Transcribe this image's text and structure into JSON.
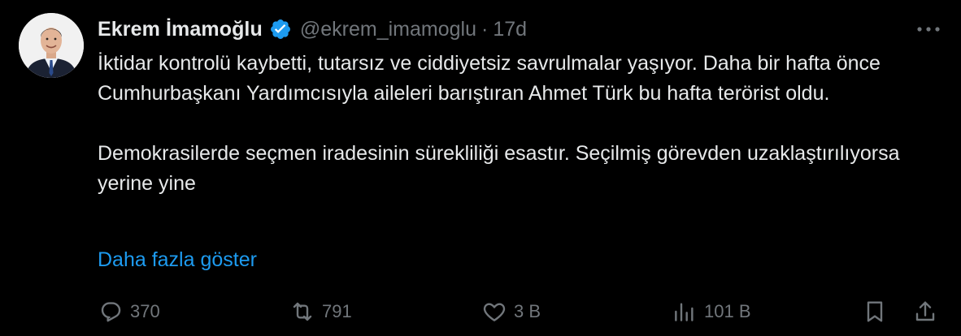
{
  "author": {
    "display_name": "Ekrem İmamoğlu",
    "handle": "@ekrem_imamoglu",
    "separator": "·",
    "time": "17d",
    "verified_icon": "verified-badge-icon"
  },
  "tweet": {
    "paragraphs": [
      "İktidar kontrolü kaybetti, tutarsız ve ciddiyetsiz savrulmalar yaşıyor. Daha bir hafta önce Cumhurbaşkanı Yardımcısıyla aileleri barıştıran Ahmet Türk bu hafta terörist oldu.",
      "Demokrasilerde seçmen iradesinin sürekliliği esastır. Seçilmiş görevden uzaklaştırılıyorsa yerine yine"
    ],
    "show_more": "Daha fazla göster"
  },
  "actions": {
    "reply": {
      "count": "370",
      "icon": "reply-icon"
    },
    "repost": {
      "count": "791",
      "icon": "repost-icon"
    },
    "like": {
      "count": "3 B",
      "icon": "like-icon"
    },
    "views": {
      "count": "101 B",
      "icon": "views-icon"
    },
    "bookmark": {
      "icon": "bookmark-icon"
    },
    "share": {
      "icon": "share-icon"
    }
  },
  "colors": {
    "background": "#000000",
    "text_primary": "#e7e9ea",
    "text_secondary": "#71767b",
    "accent": "#1d9bf0"
  }
}
